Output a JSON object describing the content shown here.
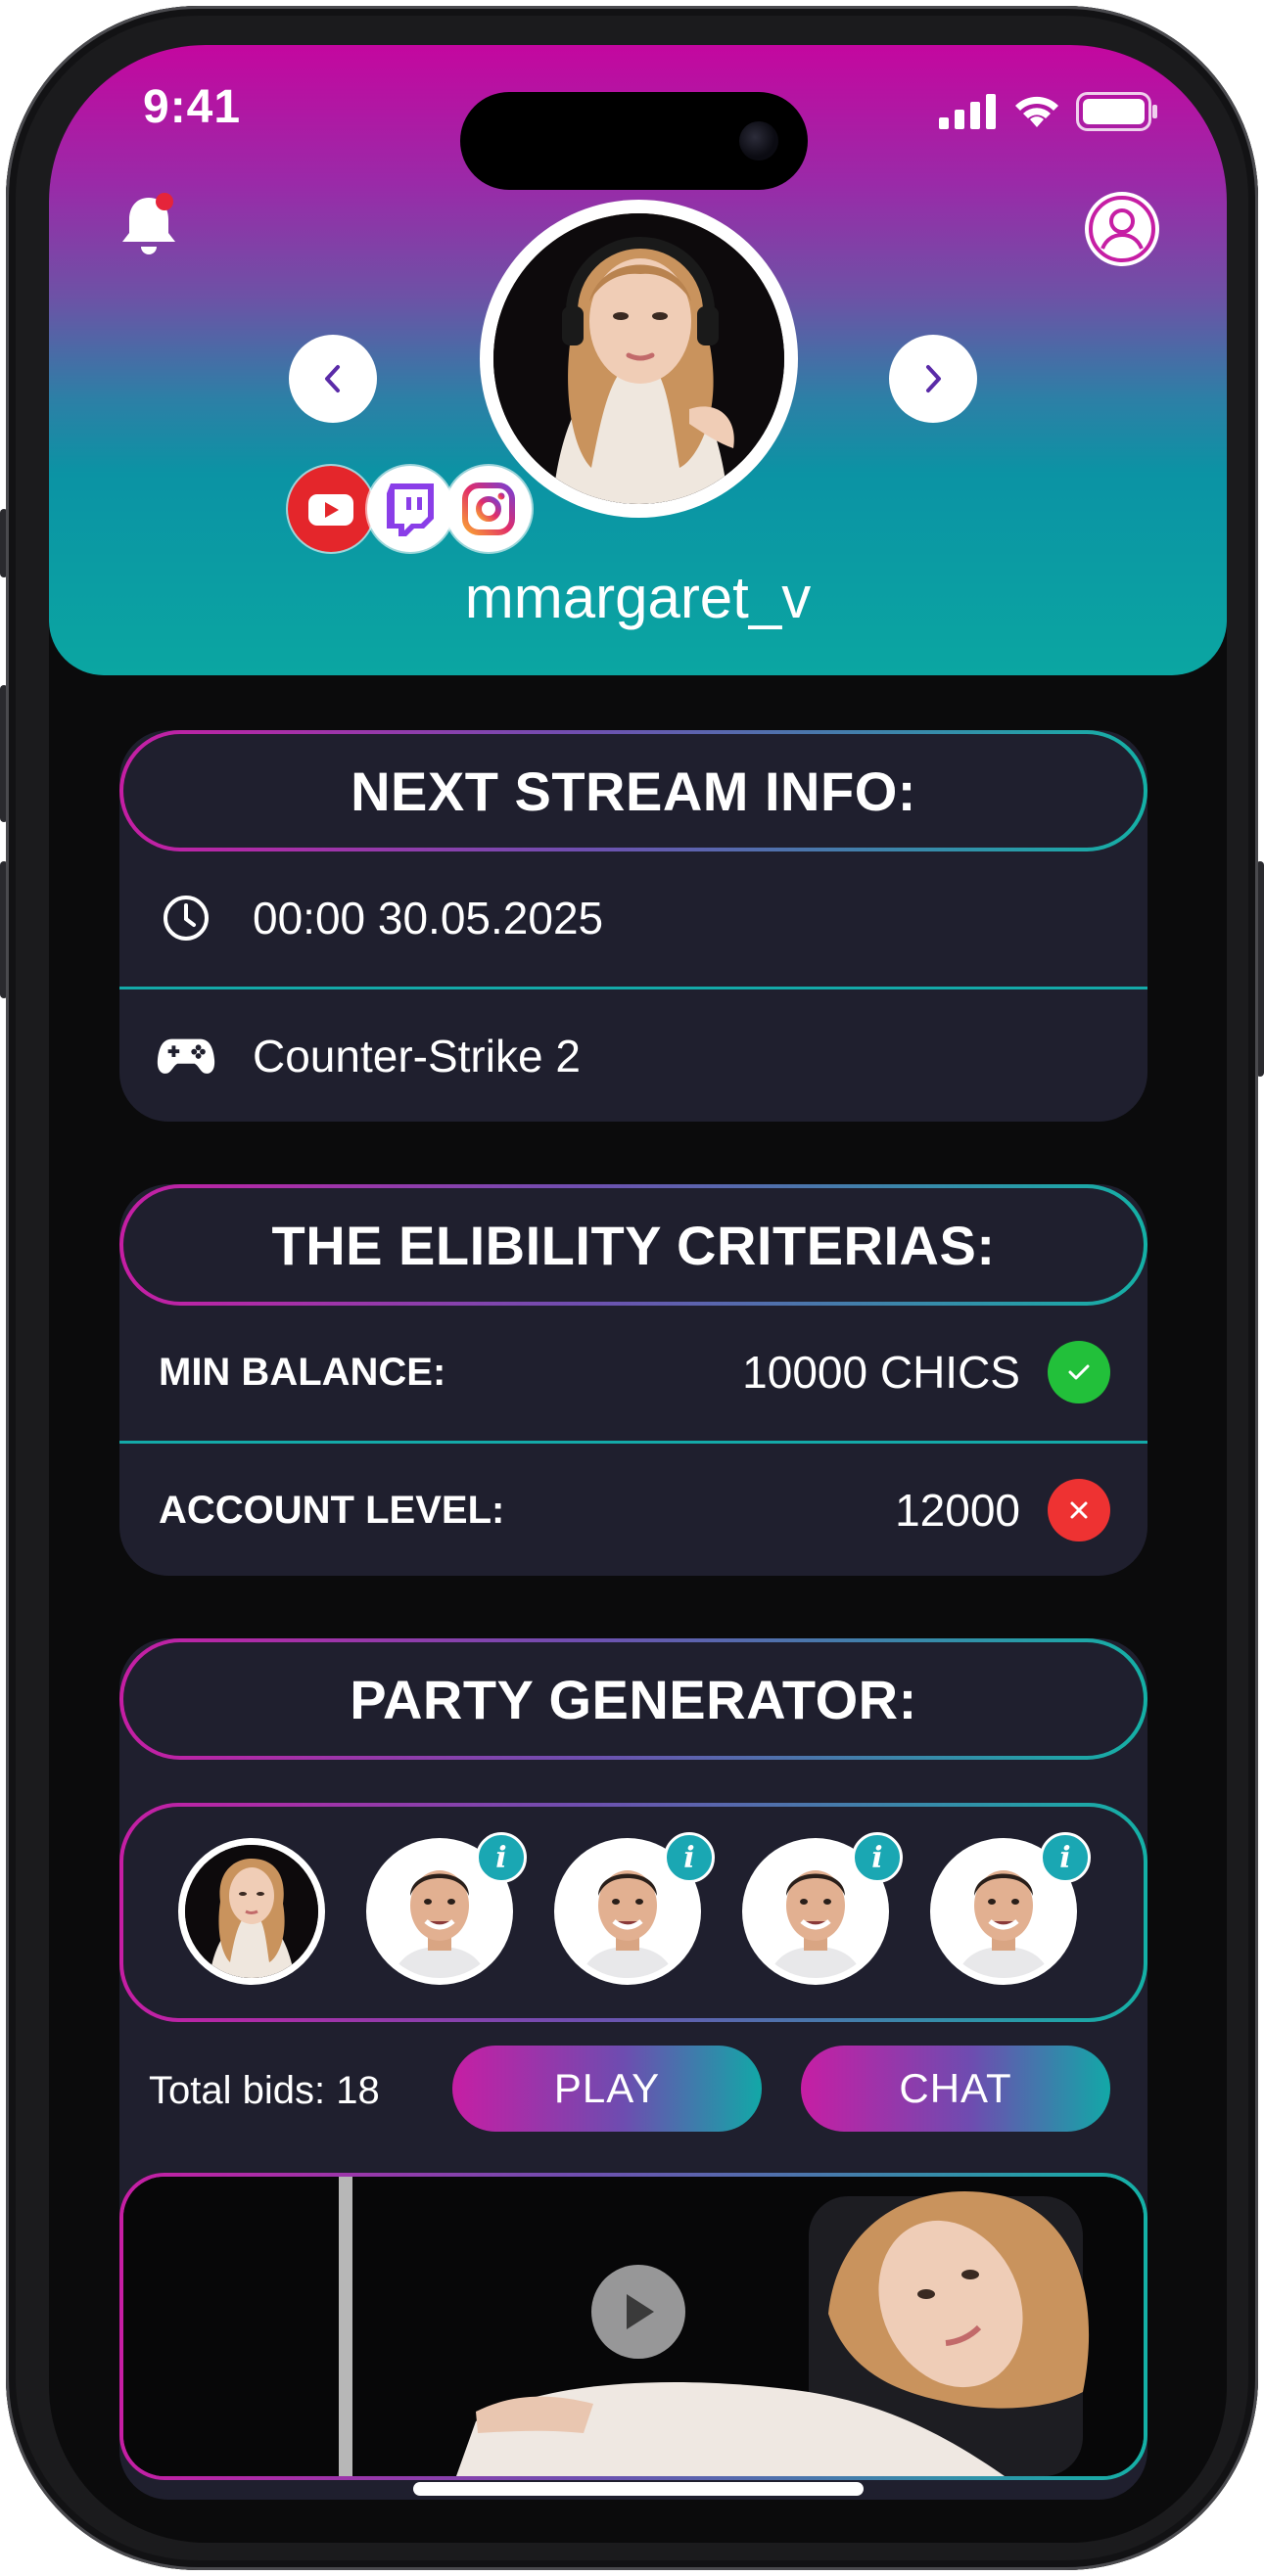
{
  "status_bar": {
    "time": "9:41"
  },
  "profile": {
    "username": "mmargaret_v",
    "socials": [
      "youtube-icon",
      "twitch-icon",
      "instagram-icon"
    ]
  },
  "next_stream": {
    "title": "NEXT STREAM INFO:",
    "datetime": "00:00 30.05.2025",
    "game": "Counter-Strike 2"
  },
  "criteria": {
    "title": "THE ELIBILITY CRITERIAS:",
    "items": [
      {
        "label": "MIN BALANCE:",
        "value": "10000 CHICS",
        "status": "ok"
      },
      {
        "label": "ACCOUNT LEVEL:",
        "value": "12000",
        "status": "fail"
      }
    ]
  },
  "party": {
    "title": "PARTY GENERATOR:",
    "members": [
      {
        "type": "host"
      },
      {
        "type": "member",
        "info": "i"
      },
      {
        "type": "member",
        "info": "i"
      },
      {
        "type": "member",
        "info": "i"
      },
      {
        "type": "member",
        "info": "i"
      }
    ],
    "total_bids": "Total bids: 18",
    "play_label": "PLAY",
    "chat_label": "CHAT"
  },
  "colors": {
    "accent_magenta": "#c61ea4",
    "accent_teal": "#14b1a6",
    "card_bg": "#1f1f2e",
    "ok": "#22c03a",
    "fail": "#ee3232"
  }
}
